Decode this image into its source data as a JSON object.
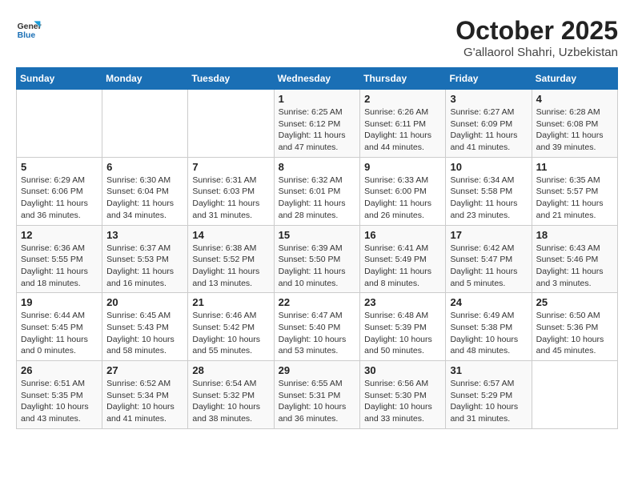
{
  "header": {
    "logo_line1": "General",
    "logo_line2": "Blue",
    "month_title": "October 2025",
    "location": "G'allaorol Shahri, Uzbekistan"
  },
  "days_of_week": [
    "Sunday",
    "Monday",
    "Tuesday",
    "Wednesday",
    "Thursday",
    "Friday",
    "Saturday"
  ],
  "weeks": [
    [
      {
        "day": "",
        "info": ""
      },
      {
        "day": "",
        "info": ""
      },
      {
        "day": "",
        "info": ""
      },
      {
        "day": "1",
        "info": "Sunrise: 6:25 AM\nSunset: 6:12 PM\nDaylight: 11 hours\nand 47 minutes."
      },
      {
        "day": "2",
        "info": "Sunrise: 6:26 AM\nSunset: 6:11 PM\nDaylight: 11 hours\nand 44 minutes."
      },
      {
        "day": "3",
        "info": "Sunrise: 6:27 AM\nSunset: 6:09 PM\nDaylight: 11 hours\nand 41 minutes."
      },
      {
        "day": "4",
        "info": "Sunrise: 6:28 AM\nSunset: 6:08 PM\nDaylight: 11 hours\nand 39 minutes."
      }
    ],
    [
      {
        "day": "5",
        "info": "Sunrise: 6:29 AM\nSunset: 6:06 PM\nDaylight: 11 hours\nand 36 minutes."
      },
      {
        "day": "6",
        "info": "Sunrise: 6:30 AM\nSunset: 6:04 PM\nDaylight: 11 hours\nand 34 minutes."
      },
      {
        "day": "7",
        "info": "Sunrise: 6:31 AM\nSunset: 6:03 PM\nDaylight: 11 hours\nand 31 minutes."
      },
      {
        "day": "8",
        "info": "Sunrise: 6:32 AM\nSunset: 6:01 PM\nDaylight: 11 hours\nand 28 minutes."
      },
      {
        "day": "9",
        "info": "Sunrise: 6:33 AM\nSunset: 6:00 PM\nDaylight: 11 hours\nand 26 minutes."
      },
      {
        "day": "10",
        "info": "Sunrise: 6:34 AM\nSunset: 5:58 PM\nDaylight: 11 hours\nand 23 minutes."
      },
      {
        "day": "11",
        "info": "Sunrise: 6:35 AM\nSunset: 5:57 PM\nDaylight: 11 hours\nand 21 minutes."
      }
    ],
    [
      {
        "day": "12",
        "info": "Sunrise: 6:36 AM\nSunset: 5:55 PM\nDaylight: 11 hours\nand 18 minutes."
      },
      {
        "day": "13",
        "info": "Sunrise: 6:37 AM\nSunset: 5:53 PM\nDaylight: 11 hours\nand 16 minutes."
      },
      {
        "day": "14",
        "info": "Sunrise: 6:38 AM\nSunset: 5:52 PM\nDaylight: 11 hours\nand 13 minutes."
      },
      {
        "day": "15",
        "info": "Sunrise: 6:39 AM\nSunset: 5:50 PM\nDaylight: 11 hours\nand 10 minutes."
      },
      {
        "day": "16",
        "info": "Sunrise: 6:41 AM\nSunset: 5:49 PM\nDaylight: 11 hours\nand 8 minutes."
      },
      {
        "day": "17",
        "info": "Sunrise: 6:42 AM\nSunset: 5:47 PM\nDaylight: 11 hours\nand 5 minutes."
      },
      {
        "day": "18",
        "info": "Sunrise: 6:43 AM\nSunset: 5:46 PM\nDaylight: 11 hours\nand 3 minutes."
      }
    ],
    [
      {
        "day": "19",
        "info": "Sunrise: 6:44 AM\nSunset: 5:45 PM\nDaylight: 11 hours\nand 0 minutes."
      },
      {
        "day": "20",
        "info": "Sunrise: 6:45 AM\nSunset: 5:43 PM\nDaylight: 10 hours\nand 58 minutes."
      },
      {
        "day": "21",
        "info": "Sunrise: 6:46 AM\nSunset: 5:42 PM\nDaylight: 10 hours\nand 55 minutes."
      },
      {
        "day": "22",
        "info": "Sunrise: 6:47 AM\nSunset: 5:40 PM\nDaylight: 10 hours\nand 53 minutes."
      },
      {
        "day": "23",
        "info": "Sunrise: 6:48 AM\nSunset: 5:39 PM\nDaylight: 10 hours\nand 50 minutes."
      },
      {
        "day": "24",
        "info": "Sunrise: 6:49 AM\nSunset: 5:38 PM\nDaylight: 10 hours\nand 48 minutes."
      },
      {
        "day": "25",
        "info": "Sunrise: 6:50 AM\nSunset: 5:36 PM\nDaylight: 10 hours\nand 45 minutes."
      }
    ],
    [
      {
        "day": "26",
        "info": "Sunrise: 6:51 AM\nSunset: 5:35 PM\nDaylight: 10 hours\nand 43 minutes."
      },
      {
        "day": "27",
        "info": "Sunrise: 6:52 AM\nSunset: 5:34 PM\nDaylight: 10 hours\nand 41 minutes."
      },
      {
        "day": "28",
        "info": "Sunrise: 6:54 AM\nSunset: 5:32 PM\nDaylight: 10 hours\nand 38 minutes."
      },
      {
        "day": "29",
        "info": "Sunrise: 6:55 AM\nSunset: 5:31 PM\nDaylight: 10 hours\nand 36 minutes."
      },
      {
        "day": "30",
        "info": "Sunrise: 6:56 AM\nSunset: 5:30 PM\nDaylight: 10 hours\nand 33 minutes."
      },
      {
        "day": "31",
        "info": "Sunrise: 6:57 AM\nSunset: 5:29 PM\nDaylight: 10 hours\nand 31 minutes."
      },
      {
        "day": "",
        "info": ""
      }
    ]
  ]
}
